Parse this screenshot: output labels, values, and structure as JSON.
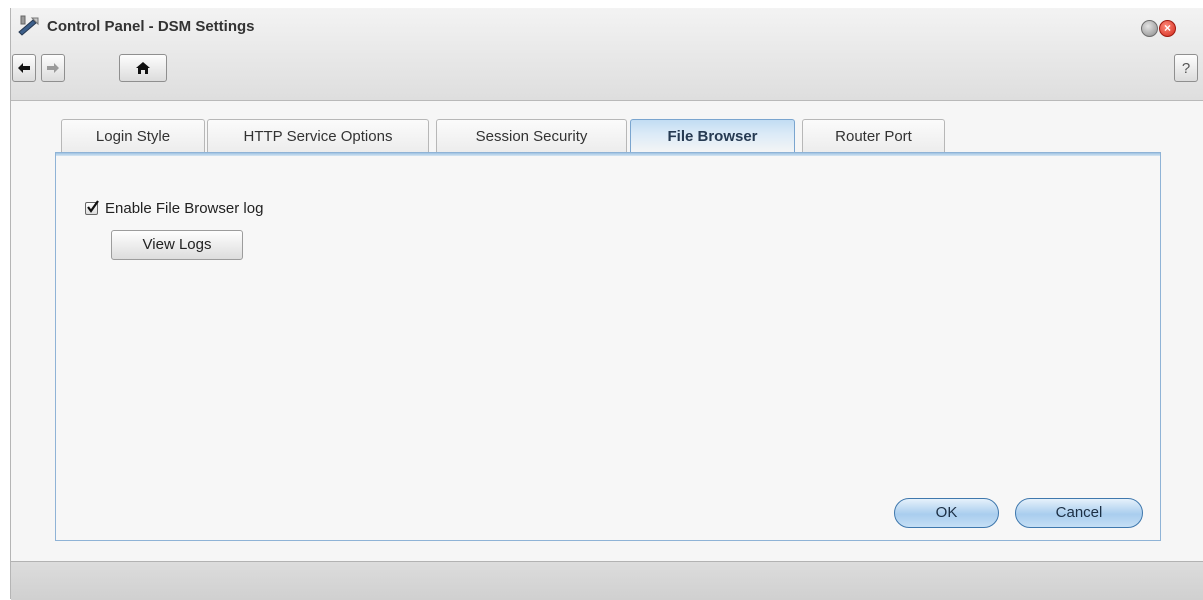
{
  "window": {
    "title": "Control Panel - DSM Settings"
  },
  "toolbar": {
    "back_icon": "arrow-left-icon",
    "forward_icon": "arrow-right-icon",
    "home_icon": "home-icon",
    "help_label": "?"
  },
  "tabs": [
    {
      "label": "Login Style",
      "active": false
    },
    {
      "label": "HTTP Service Options",
      "active": false
    },
    {
      "label": "Session Security",
      "active": false
    },
    {
      "label": "File Browser",
      "active": true
    },
    {
      "label": "Router Port",
      "active": false
    }
  ],
  "content": {
    "enable_log_label": "Enable File Browser log",
    "enable_log_checked": true,
    "view_logs_label": "View Logs"
  },
  "actions": {
    "ok_label": "OK",
    "cancel_label": "Cancel"
  },
  "colors": {
    "accent": "#a9cdee",
    "active_tab_border": "#7aa5cf",
    "close_button": "#d2281b"
  }
}
